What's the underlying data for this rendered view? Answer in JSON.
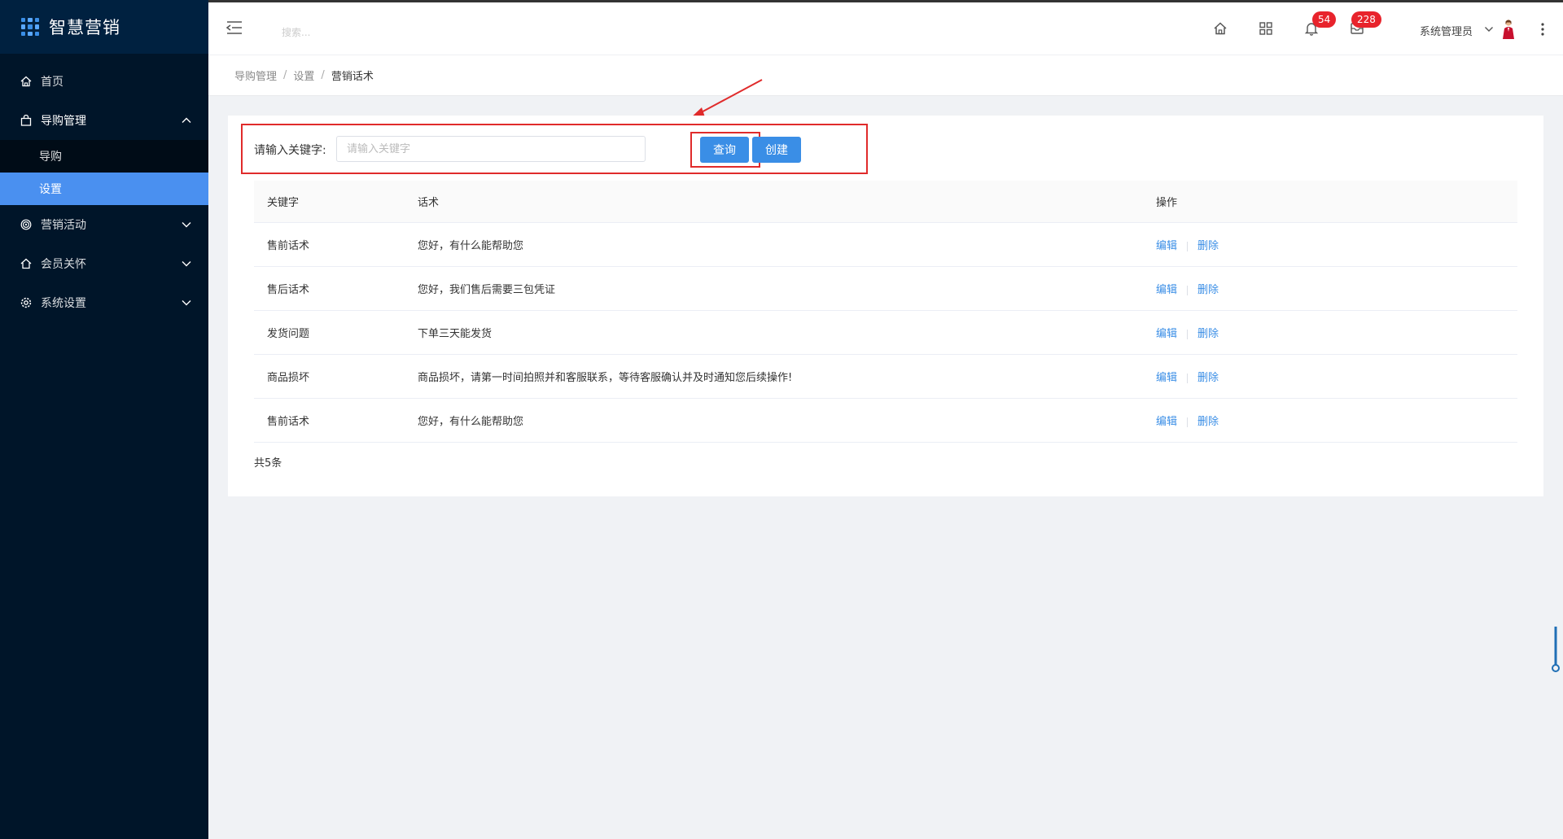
{
  "app": {
    "title": "智慧营销"
  },
  "sidebar": {
    "items": [
      {
        "label": "首页",
        "icon": "home-icon"
      },
      {
        "label": "导购管理",
        "icon": "bag-icon",
        "open": true,
        "children": [
          {
            "label": "导购"
          },
          {
            "label": "设置",
            "active": true
          }
        ]
      },
      {
        "label": "营销活动",
        "icon": "target-icon"
      },
      {
        "label": "会员关怀",
        "icon": "house-icon"
      },
      {
        "label": "系统设置",
        "icon": "gear-icon"
      }
    ]
  },
  "header": {
    "search_placeholder": "搜索...",
    "notifications_badge": "54",
    "messages_badge": "228",
    "user_name": "系统管理员"
  },
  "breadcrumb": [
    "导购管理",
    "设置",
    "营销话术"
  ],
  "filter": {
    "label": "请输入关键字:",
    "placeholder": "请输入关键字",
    "query_label": "查询",
    "create_label": "创建"
  },
  "table": {
    "columns": [
      "关键字",
      "话术",
      "操作"
    ],
    "rows": [
      {
        "keyword": "售前话术",
        "script": "您好，有什么能帮助您"
      },
      {
        "keyword": "售后话术",
        "script": "您好，我们售后需要三包凭证"
      },
      {
        "keyword": "发货问题",
        "script": "下单三天能发货"
      },
      {
        "keyword": "商品损坏",
        "script": "商品损坏，请第一时间拍照并和客服联系，等待客服确认并及时通知您后续操作!"
      },
      {
        "keyword": "售前话术",
        "script": "您好，有什么能帮助您"
      }
    ],
    "edit_label": "编辑",
    "delete_label": "删除",
    "total": "共5条"
  },
  "colors": {
    "sidebar_bg": "#001529",
    "primary": "#3a8ee6",
    "highlight": "#e02b2b",
    "badge": "#e8232c"
  }
}
